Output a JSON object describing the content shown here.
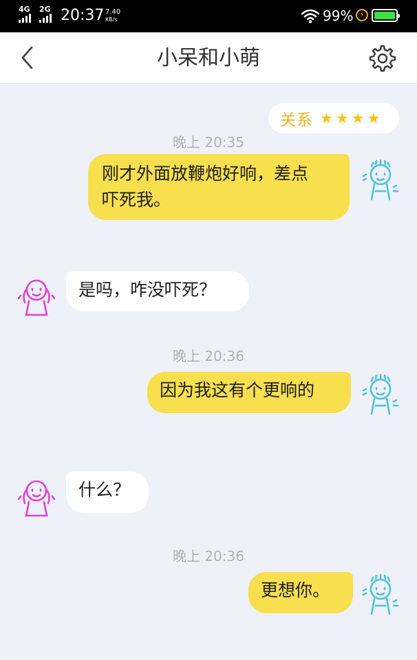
{
  "status_bar": {
    "network_1": "4G",
    "network_2": "2G",
    "time": "20:37",
    "speed_value": "7.40",
    "speed_unit": "KB/s",
    "battery_percent": "99%",
    "battery_level": 0.99
  },
  "header": {
    "title": "小呆和小萌",
    "back_icon": "chevron-left-icon",
    "settings_icon": "gear-icon"
  },
  "relation": {
    "label": "关系",
    "stars": [
      "★",
      "★",
      "★",
      "★"
    ],
    "star_count": 4
  },
  "messages": [
    {
      "timestamp": "晚上 20:35"
    },
    {
      "sender": "me",
      "text": "刚才外面放鞭炮好响，差点\n吓死我。"
    },
    {
      "sender": "her",
      "text": "是吗，咋没吓死？"
    },
    {
      "timestamp": "晚上 20:36"
    },
    {
      "sender": "me",
      "text": "因为我这有个更响的"
    },
    {
      "sender": "her",
      "text": "什么？"
    },
    {
      "timestamp": "晚上 20:36"
    },
    {
      "sender": "me",
      "text": "更想你。"
    }
  ],
  "colors": {
    "chat_background": "#eef1f7",
    "outgoing_bubble": "#f7df4e",
    "incoming_bubble": "#ffffff",
    "timestamp_text": "#aeb2b9",
    "my_avatar": "#4cc3dc",
    "her_avatar": "#e040d8",
    "relation_accent": "#f2b21a"
  }
}
